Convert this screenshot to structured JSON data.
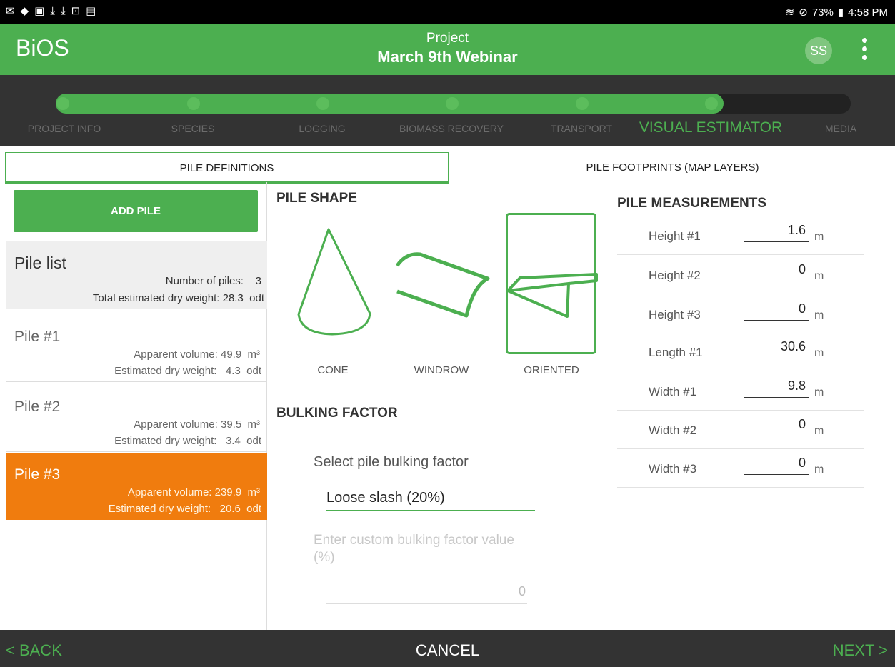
{
  "status_bar": {
    "left_icons": [
      "mail-icon",
      "bag-icon",
      "image-icon",
      "download-icon",
      "download-icon",
      "lock-wifi-icon",
      "file-icon"
    ],
    "battery": "73%",
    "time": "4:58 PM"
  },
  "app_bar": {
    "brand": "BiOS",
    "project_label": "Project",
    "project_name": "March 9th Webinar",
    "avatar": "SS"
  },
  "stepper": {
    "steps": [
      "PROJECT INFO",
      "SPECIES",
      "LOGGING",
      "BIOMASS RECOVERY",
      "TRANSPORT",
      "VISUAL ESTIMATOR",
      "MEDIA"
    ],
    "active_index": 5
  },
  "tabs": [
    "PILE DEFINITIONS",
    "PILE FOOTPRINTS (MAP LAYERS)"
  ],
  "left": {
    "add_button": "ADD PILE",
    "summary": {
      "title": "Pile list",
      "count_line": "Number of piles:    3",
      "weight_line": "Total estimated dry weight: 28.3  odt"
    },
    "piles": [
      {
        "name": "Pile #1",
        "volume": "Apparent volume: 49.9  m³",
        "weight": "Estimated dry weight:   4.3  odt"
      },
      {
        "name": "Pile #2",
        "volume": "Apparent volume: 39.5  m³",
        "weight": "Estimated dry weight:   3.4  odt"
      },
      {
        "name": "Pile #3",
        "volume": "Apparent volume: 239.9  m³",
        "weight": "Estimated dry weight:   20.6  odt"
      }
    ]
  },
  "shape": {
    "title": "PILE SHAPE",
    "options": [
      "CONE",
      "WINDROW",
      "ORIENTED"
    ],
    "selected": "ORIENTED"
  },
  "bulking": {
    "title": "BULKING FACTOR",
    "select_label": "Select pile bulking factor",
    "selected_value": "Loose slash (20%)",
    "custom_label": "Enter custom bulking factor value (%)",
    "custom_value": "0"
  },
  "measurements": {
    "title": "PILE MEASUREMENTS",
    "unit": "m",
    "rows": [
      {
        "label": "Height #1",
        "value": "1.6"
      },
      {
        "label": "Height #2",
        "value": "0"
      },
      {
        "label": "Height #3",
        "value": "0"
      },
      {
        "label": "Length #1",
        "value": "30.6"
      },
      {
        "label": "Width #1",
        "value": "9.8"
      },
      {
        "label": "Width #2",
        "value": "0"
      },
      {
        "label": "Width #3",
        "value": "0"
      }
    ]
  },
  "bottom_bar": {
    "back": "< BACK",
    "cancel": "CANCEL",
    "next": "NEXT >"
  },
  "colors": {
    "primary": "#4caf50",
    "selected_pile": "#f07c0e",
    "dark_bar": "#333333"
  }
}
